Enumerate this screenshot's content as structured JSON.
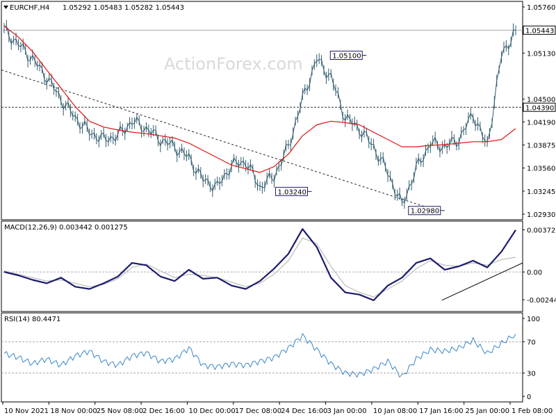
{
  "header": {
    "symbol": "EURCHF,H4",
    "ohlc": "1.05292 1.05483 1.05282 1.05443",
    "macd_title": "MACD(12,26,9) 0.003442 0.001275",
    "rsi_title": "RSI(14) 80.4471",
    "watermark": "ActionForex.com"
  },
  "colors": {
    "price": "#2e5a6b",
    "ma": "#dd1111",
    "macd": "#1a1a6e",
    "signal": "#bbbbbb",
    "rsi": "#3a86c8",
    "levels": "#555555",
    "grid": "#bbbbbb"
  },
  "chart_data": [
    {
      "type": "line",
      "panel": "price",
      "ylim": [
        1.0293,
        1.0576
      ],
      "y_ticks": [
        "1.05760",
        "1.05130",
        "1.04500",
        "1.04190",
        "1.03875",
        "1.03560",
        "1.03245",
        "1.02930"
      ],
      "current_price_label": "1.05443",
      "x": [
        "10 Nov 2021",
        "18 Nov 00:00",
        "25 Nov 08:00",
        "2 Dec 16:00",
        "10 Dec 00:00",
        "17 Dec 08:00",
        "24 Dec 16:00",
        "3 Jan 00:00",
        "10 Jan 08:00",
        "17 Jan 16:00",
        "25 Jan 00:00",
        "1 Feb 08:00"
      ],
      "series": [
        {
          "role": "close",
          "values": [
            1.0545,
            1.0525,
            1.0505,
            1.048,
            1.045,
            1.0425,
            1.0405,
            1.0395,
            1.04,
            1.042,
            1.041,
            1.0395,
            1.0385,
            1.037,
            1.034,
            1.033,
            1.036,
            1.0365,
            1.033,
            1.0345,
            1.0385,
            1.045,
            1.0505,
            1.048,
            1.0425,
            1.041,
            1.0385,
            1.035,
            1.0305,
            1.0355,
            1.039,
            1.0385,
            1.0395,
            1.043,
            1.0385,
            1.051,
            1.0544
          ]
        },
        {
          "role": "moving-average",
          "values": [
            1.055,
            1.0535,
            1.0515,
            1.049,
            1.0465,
            1.044,
            1.042,
            1.0412,
            1.0408,
            1.0405,
            1.0403,
            1.04,
            1.0397,
            1.039,
            1.038,
            1.037,
            1.036,
            1.0355,
            1.035,
            1.0358,
            1.0375,
            1.04,
            1.0415,
            1.042,
            1.0418,
            1.0415,
            1.0405,
            1.0395,
            1.0385,
            1.0385,
            1.0387,
            1.0388,
            1.039,
            1.0392,
            1.0392,
            1.0395,
            1.041
          ]
        }
      ],
      "levels": [
        {
          "label": "1.04390",
          "value": 1.0439
        },
        {
          "label": "1.05443",
          "value": 1.05443
        }
      ],
      "annotations": [
        {
          "label": "1.05100",
          "x_fraction": 0.695,
          "value": 1.051
        },
        {
          "label": "1.03240",
          "x_fraction": 0.59,
          "value": 1.0324
        },
        {
          "label": "1.02980",
          "x_fraction": 0.845,
          "value": 1.0298
        }
      ],
      "trendlines": [
        {
          "from": [
            0.0,
            1.049
          ],
          "to": [
            0.84,
            1.0297
          ]
        }
      ]
    },
    {
      "type": "line",
      "panel": "macd",
      "ylim": [
        -0.003,
        0.004
      ],
      "y_ticks": [
        "0.003722",
        "0.00",
        "-0.002449"
      ],
      "series": [
        {
          "role": "macd",
          "values": [
            0.0,
            -0.0003,
            -0.0007,
            -0.001,
            -0.0005,
            -0.0013,
            -0.0015,
            -0.001,
            -0.0004,
            0.0008,
            0.0006,
            -0.0004,
            -0.0008,
            0.0002,
            -0.0006,
            -0.0005,
            -0.0012,
            -0.0015,
            -0.0008,
            0.0003,
            0.0016,
            0.0038,
            0.0022,
            -0.0005,
            -0.0018,
            -0.002,
            -0.0025,
            -0.0012,
            -0.0005,
            0.0008,
            0.0012,
            0.0002,
            0.0005,
            0.001,
            0.0004,
            0.0018,
            0.0037
          ]
        },
        {
          "role": "signal",
          "values": [
            0.0001,
            -0.0002,
            -0.0005,
            -0.0008,
            -0.0007,
            -0.001,
            -0.0013,
            -0.0011,
            -0.0006,
            0.0004,
            0.0007,
            0.0001,
            -0.0005,
            -0.0002,
            -0.0003,
            -0.0005,
            -0.0009,
            -0.0013,
            -0.001,
            -0.0002,
            0.001,
            0.003,
            0.0025,
            0.0005,
            -0.0012,
            -0.0018,
            -0.0022,
            -0.0015,
            -0.0008,
            0.0003,
            0.001,
            0.0006,
            0.0005,
            0.0008,
            0.0006,
            0.0011,
            0.0013
          ]
        }
      ]
    },
    {
      "type": "line",
      "panel": "rsi",
      "ylim": [
        0,
        100
      ],
      "y_ticks": [
        "100",
        "70",
        "30",
        "0"
      ],
      "series": [
        {
          "role": "rsi",
          "values": [
            55,
            50,
            42,
            48,
            40,
            52,
            58,
            45,
            40,
            52,
            56,
            45,
            48,
            62,
            40,
            38,
            42,
            40,
            45,
            50,
            62,
            78,
            60,
            42,
            30,
            28,
            35,
            45,
            25,
            48,
            60,
            58,
            62,
            72,
            55,
            68,
            80
          ]
        }
      ],
      "levels": [
        70,
        30
      ]
    }
  ]
}
